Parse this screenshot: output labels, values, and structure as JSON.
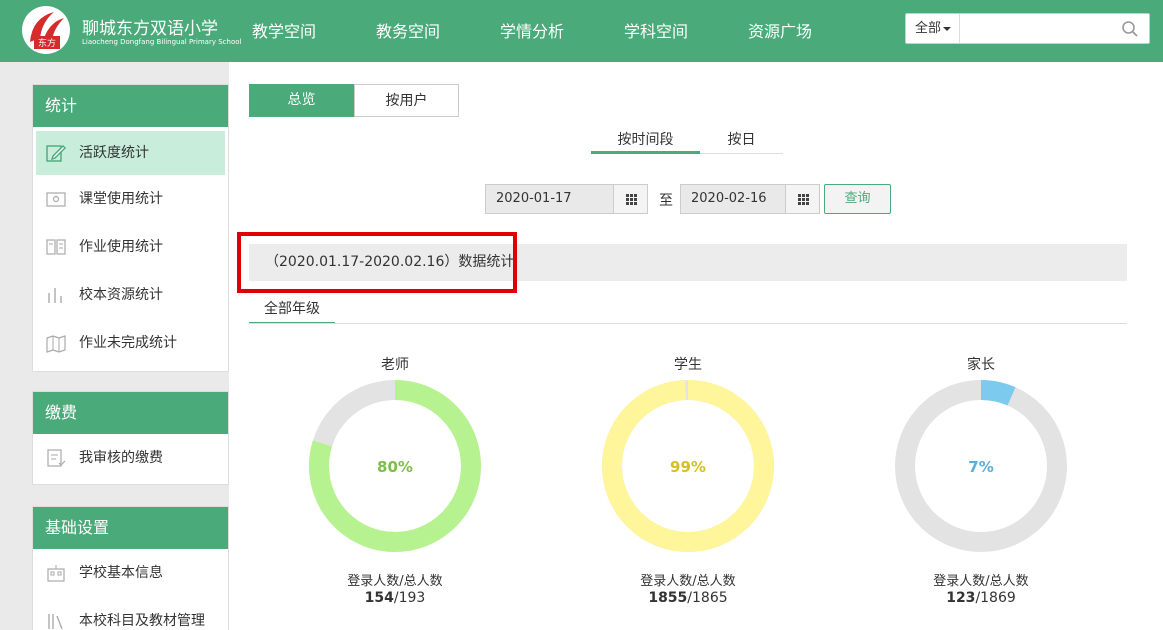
{
  "header": {
    "logo_text": "东方",
    "school_name": "聊城东方双语小学",
    "school_name_en": "Liaocheng Dongfang Bilingual Primary School",
    "nav": [
      "教学空间",
      "教务空间",
      "学情分析",
      "学科空间",
      "资源广场"
    ],
    "search_scope": "全部",
    "search_placeholder": ""
  },
  "sidebar": {
    "sections": [
      {
        "title": "统计",
        "items": [
          "活跃度统计",
          "课堂使用统计",
          "作业使用统计",
          "校本资源统计",
          "作业未完成统计"
        ]
      },
      {
        "title": "缴费",
        "items": [
          "我审核的缴费"
        ]
      },
      {
        "title": "基础设置",
        "items": [
          "学校基本信息",
          "本校科目及教材管理"
        ]
      }
    ],
    "active_item": "活跃度统计"
  },
  "main": {
    "tabs": [
      "总览",
      "按用户"
    ],
    "sub_tabs": [
      "按时间段",
      "按日"
    ],
    "start_date": "2020-01-17",
    "end_date": "2020-02-16",
    "to_label": "至",
    "query_label": "查询",
    "stat_title": "（2020.01.17-2020.02.16）数据统计",
    "grade_tab": "全部年级"
  },
  "charts": [
    {
      "title": "老师",
      "percent_label": "80%",
      "fraction": 0.7979,
      "color": "#b6f28f",
      "text_color": "#7bbf4a",
      "caption": "登录人数/总人数",
      "logged_in": "154",
      "total": "/193"
    },
    {
      "title": "学生",
      "percent_label": "99%",
      "fraction": 0.9946,
      "color": "#fff59a",
      "text_color": "#d4c020",
      "caption": "登录人数/总人数",
      "logged_in": "1855",
      "total": "/1865"
    },
    {
      "title": "家长",
      "percent_label": "7%",
      "fraction": 0.0658,
      "color": "#7ccbef",
      "text_color": "#5aaed6",
      "caption": "登录人数/总人数",
      "logged_in": "123",
      "total": "/1869"
    }
  ]
}
